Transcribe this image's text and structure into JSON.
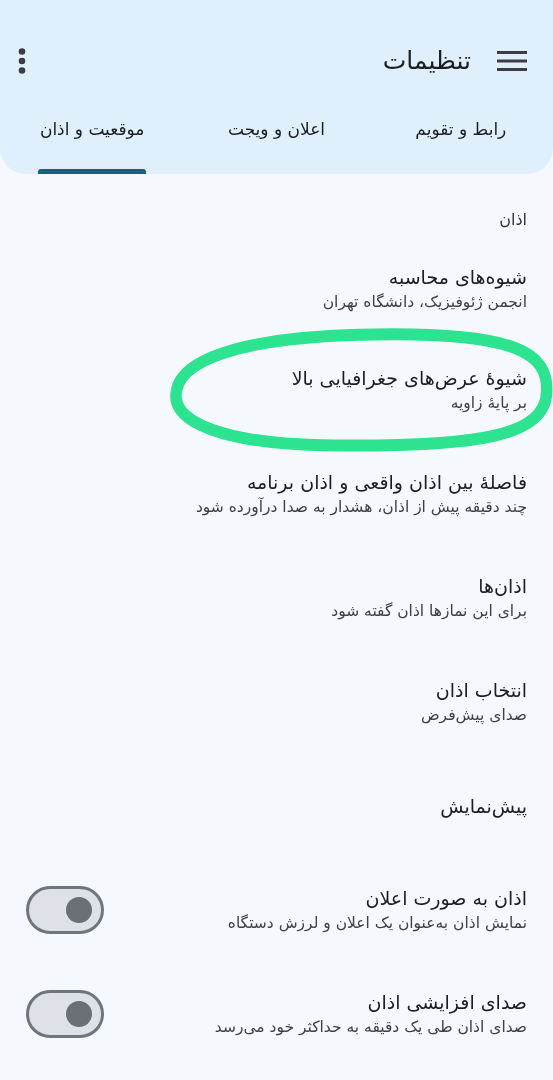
{
  "app_bar": {
    "title": "تنظیمات"
  },
  "tabs": [
    {
      "label": "رابط و تقویم",
      "selected": false
    },
    {
      "label": "اعلان و ویجت",
      "selected": false
    },
    {
      "label": "موقعیت و اذان",
      "selected": true
    }
  ],
  "section": {
    "header": "اذان"
  },
  "settings": [
    {
      "kind": "text",
      "title": "شیوه‌های محاسبه",
      "summary": "انجمن ژئوفیزیک، دانشگاه تهران"
    },
    {
      "kind": "text",
      "title": "شیوهٔ عرض‌های جغرافیایی بالا",
      "summary": "بر پایهٔ زاویه",
      "circled": true
    },
    {
      "kind": "text",
      "title": "فاصلهٔ بین اذان واقعی و اذان برنامه",
      "summary": "چند دقیقه پیش از اذان، هشدار به صدا درآورده شود"
    },
    {
      "kind": "text",
      "title": "اذان‌ها",
      "summary": "برای این نمازها اذان گفته شود"
    },
    {
      "kind": "text",
      "title": "انتخاب اذان",
      "summary": "صدای پیش‌فرض"
    },
    {
      "kind": "text",
      "title": "پیش‌نمایش"
    },
    {
      "kind": "switch",
      "title": "اذان به صورت اعلان",
      "summary": "نمایش اذان به‌عنوان یک اعلان و لرزش دستگاه",
      "on": false
    },
    {
      "kind": "switch",
      "title": "صدای افزایشی اذان",
      "summary": "صدای اذان طی یک دقیقه به حداکثر خود می‌رسد",
      "on": false
    }
  ]
}
